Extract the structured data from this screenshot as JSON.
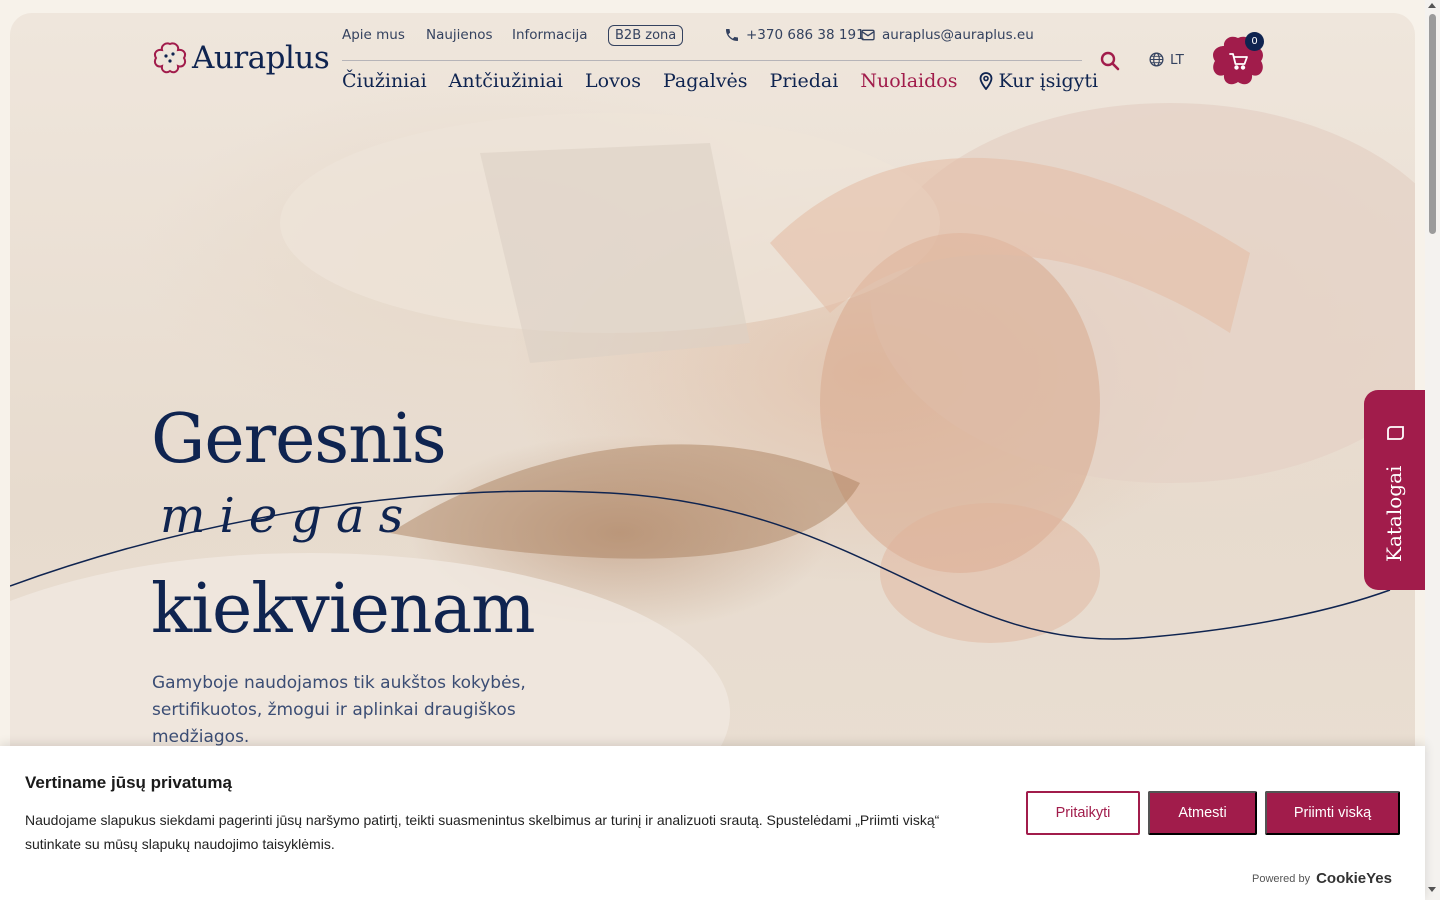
{
  "brand": {
    "name": "Auraplus"
  },
  "topbar": {
    "links": [
      "Apie mus",
      "Naujienos",
      "Informacija"
    ],
    "b2b": "B2B zona",
    "phone": "+370 686 38 191",
    "email": "auraplus@auraplus.eu",
    "language": "LT",
    "cart_count": "0"
  },
  "nav": {
    "items": [
      "Čiužiniai",
      "Antčiužiniai",
      "Lovos",
      "Pagalvės",
      "Priedai",
      "Nuolaidos"
    ],
    "where_to_buy": "Kur įsigyti"
  },
  "hero": {
    "line1": "Geresnis",
    "script": "miegas",
    "line2": "kiekvienam",
    "lead": "Gamyboje naudojamos tik aukštos kokybės, sertifikuotos, žmogui ir aplinkai draugiškos medžiagos."
  },
  "catalog_tab": {
    "label": "Katalogai"
  },
  "cookie": {
    "title": "Vertiname jūsų privatumą",
    "text": "Naudojame slapukus siekdami pagerinti jūsų naršymo patirtį, teikti suasmenintus skelbimus ar turinį ir analizuoti srautą. Spustelėdami „Priimti viską“ sutinkate su mūsų slapukų naudojimo taisyklėmis.",
    "customize": "Pritaikyti",
    "reject": "Atmesti",
    "accept": "Priimti viską",
    "powered_by": "Powered by",
    "powered_brand": "CookieYes"
  },
  "colors": {
    "accent": "#a11c4b",
    "navy": "#0f2450",
    "background": "#f7f2ea"
  },
  "icons": [
    "logo-flower-icon",
    "phone-icon",
    "mail-icon",
    "search-icon",
    "globe-icon",
    "cart-icon",
    "location-pin-icon",
    "book-icon"
  ]
}
